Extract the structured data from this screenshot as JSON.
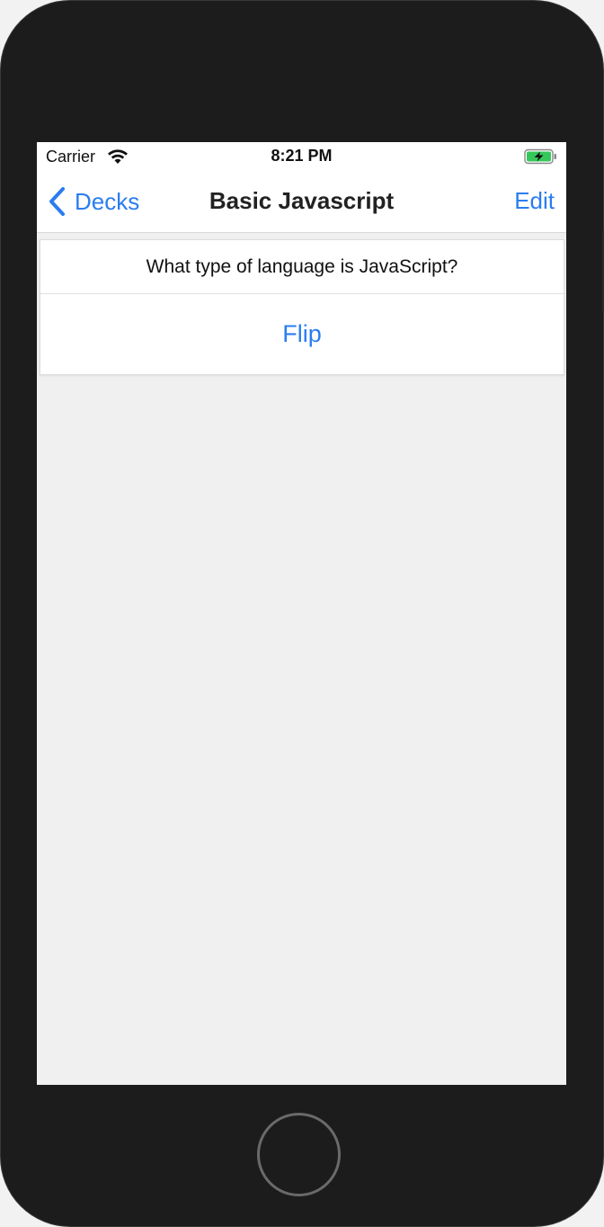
{
  "status_bar": {
    "carrier": "Carrier",
    "time": "8:21 PM",
    "wifi_icon": "wifi-icon",
    "battery_icon": "battery-charging-icon",
    "battery_color": "#35c759"
  },
  "nav": {
    "back_label": "Decks",
    "back_icon": "chevron-left-icon",
    "title": "Basic Javascript",
    "edit_label": "Edit"
  },
  "card": {
    "question": "What type of language is JavaScript?",
    "flip_label": "Flip"
  },
  "colors": {
    "accent": "#2a7df0",
    "background": "#f0f0f0",
    "device": "#1c1c1c"
  }
}
